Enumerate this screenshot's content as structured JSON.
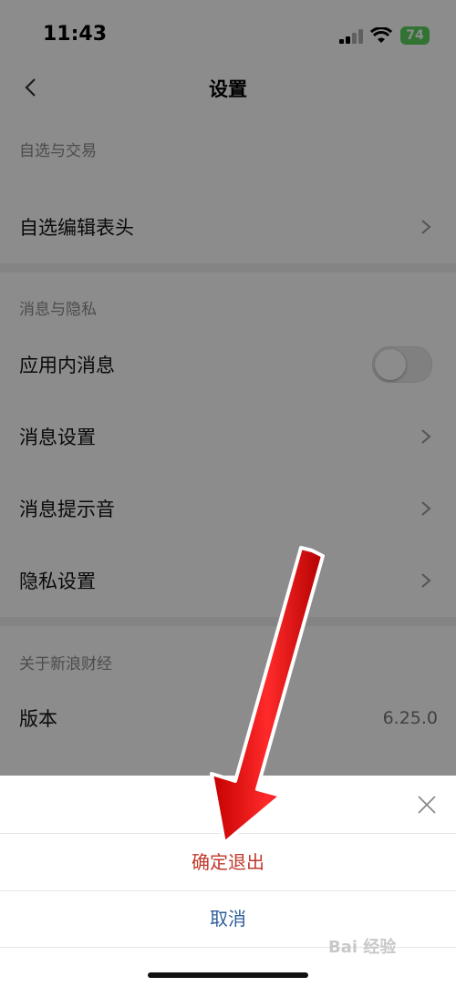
{
  "status": {
    "time": "11:43",
    "battery": "74"
  },
  "nav": {
    "title": "设置"
  },
  "sections": {
    "watchlist": {
      "header": "自选与交易",
      "items": [
        {
          "label": "自选编辑表头"
        }
      ]
    },
    "privacy": {
      "header": "消息与隐私",
      "items": [
        {
          "label": "应用内消息",
          "toggle_on": false
        },
        {
          "label": "消息设置"
        },
        {
          "label": "消息提示音"
        },
        {
          "label": "隐私设置"
        }
      ]
    },
    "about": {
      "header": "关于新浪财经",
      "version_label": "版本",
      "version_value": "6.25.0"
    }
  },
  "sheet": {
    "confirm_label": "确定退出",
    "cancel_label": "取消"
  },
  "watermark": "Bai 经验",
  "colors": {
    "confirm": "#c0392b",
    "cancel": "#2f5e9c",
    "arrow": "#ee1c1c",
    "toggle_track": "#e9e9ea"
  }
}
